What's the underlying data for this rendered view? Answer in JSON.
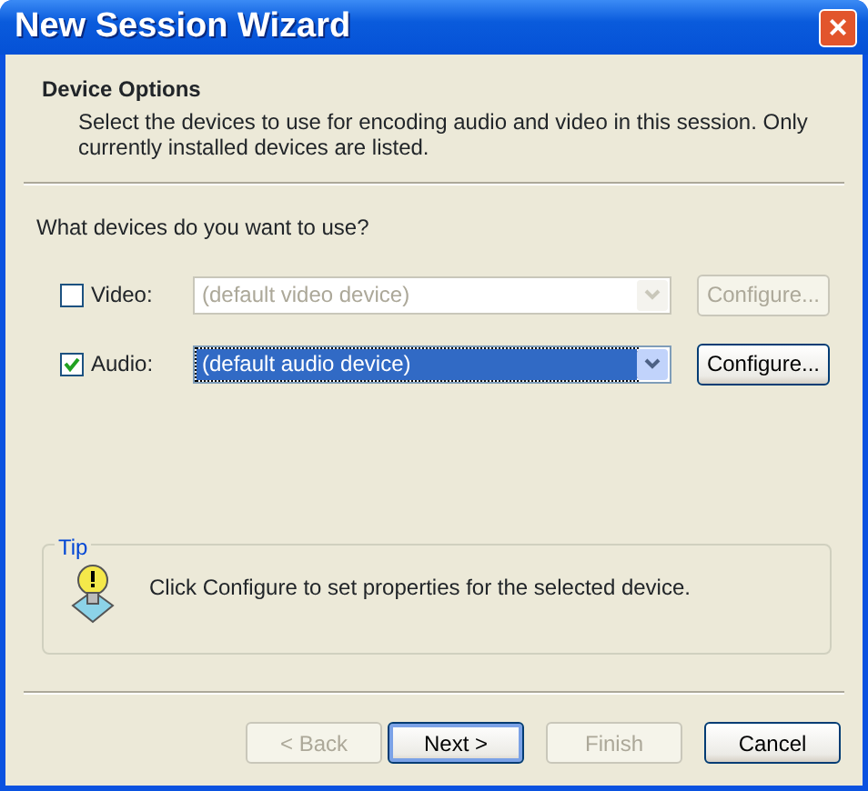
{
  "window": {
    "title": "New Session Wizard",
    "close": "×"
  },
  "header": {
    "title": "Device Options",
    "description": "Select the devices to use for encoding audio and video in this session. Only currently installed devices are listed."
  },
  "question": "What devices do you want to use?",
  "devices": [
    {
      "label": "Video:",
      "checked": false,
      "value": "(default video device)",
      "focused": false,
      "configure": "Configure..."
    },
    {
      "label": "Audio:",
      "checked": true,
      "value": "(default audio device)",
      "focused": true,
      "configure": "Configure..."
    }
  ],
  "tip": {
    "label": "Tip",
    "text": "Click Configure to set properties for the selected device."
  },
  "buttons": [
    {
      "label": "< Back",
      "disabled": true,
      "default": false
    },
    {
      "label": "Next >",
      "disabled": false,
      "default": true
    },
    {
      "label": "Finish",
      "disabled": true,
      "default": false
    },
    {
      "label": "Cancel",
      "disabled": false,
      "default": false
    }
  ]
}
